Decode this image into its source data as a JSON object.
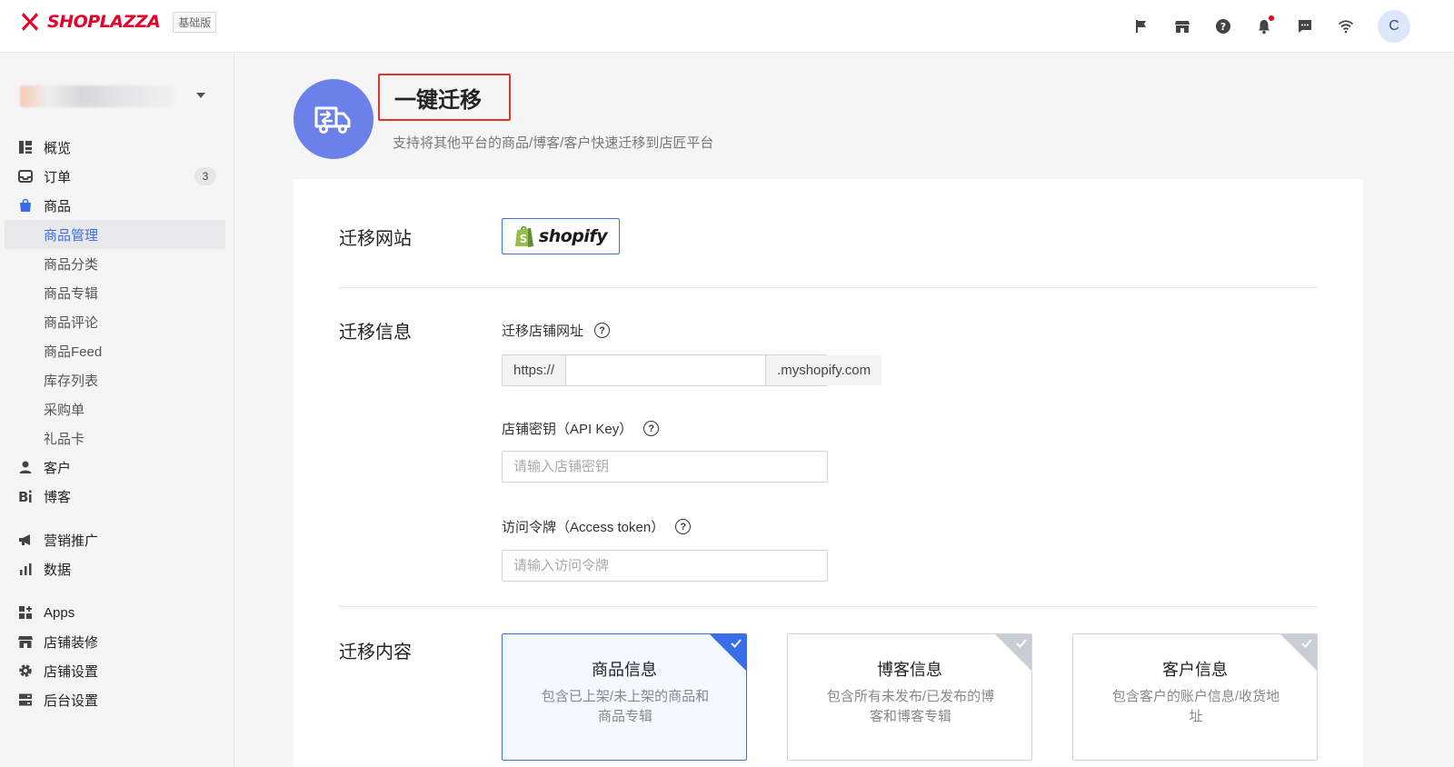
{
  "header": {
    "brand": "SHOPLAZZA",
    "plan_badge": "基础版",
    "avatar_letter": "C",
    "brand_color": "#e4002b"
  },
  "sidebar": {
    "items": [
      {
        "label": "概览",
        "icon": "dashboard-icon"
      },
      {
        "label": "订单",
        "icon": "inbox-icon",
        "badge": "3"
      },
      {
        "label": "商品",
        "icon": "shopping-bag-icon"
      }
    ],
    "product_sub": [
      "商品管理",
      "商品分类",
      "商品专辑",
      "商品评论",
      "商品Feed",
      "库存列表",
      "采购单",
      "礼品卡"
    ],
    "items2": [
      {
        "label": "客户",
        "icon": "user-icon"
      },
      {
        "label": "博客",
        "icon": "blog-icon"
      }
    ],
    "items3": [
      {
        "label": "营销推广",
        "icon": "megaphone-icon"
      },
      {
        "label": "数据",
        "icon": "bar-chart-icon"
      }
    ],
    "items4": [
      {
        "label": "Apps",
        "icon": "apps-icon"
      },
      {
        "label": "店铺装修",
        "icon": "store-icon"
      },
      {
        "label": "店铺设置",
        "icon": "gear-icon"
      },
      {
        "label": "后台设置",
        "icon": "server-icon"
      }
    ]
  },
  "main": {
    "title": "一键迁移",
    "subtitle": "支持将其他平台的商品/博客/客户快速迁移到店匠平台",
    "sections": {
      "site": "迁移网站",
      "info": "迁移信息",
      "content": "迁移内容"
    },
    "shopify_label": "shopify",
    "fields": {
      "store_url_label": "迁移店铺网址",
      "url_prefix": "https://",
      "url_value": "",
      "url_suffix": ".myshopify.com",
      "api_key_label": "店铺密钥（API Key）",
      "api_key_placeholder": "请输入店铺密钥",
      "token_label": "访问令牌（Access token）",
      "token_placeholder": "请输入访问令牌"
    },
    "options": [
      {
        "title": "商品信息",
        "desc": "包含已上架/未上架的商品和商品专辑",
        "selected": true
      },
      {
        "title": "博客信息",
        "desc": "包含所有未发布/已发布的博客和博客专辑",
        "selected": false
      },
      {
        "title": "客户信息",
        "desc": "包含客户的账户信息/收货地址",
        "selected": false
      }
    ],
    "accent_color": "#3a6ee8",
    "hero_color": "#6b80e8"
  }
}
